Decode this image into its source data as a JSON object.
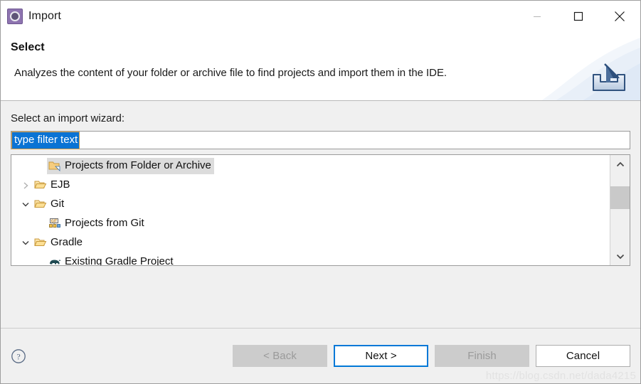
{
  "window": {
    "title": "Import",
    "icon": "eclipse-import-icon",
    "controls": {
      "minimize": "minimize-icon",
      "maximize": "maximize-icon",
      "close": "close-icon"
    }
  },
  "header": {
    "title": "Select",
    "description": "Analyzes the content of your folder or archive file to find projects and import them in the IDE.",
    "banner_icon": "import-banner-icon"
  },
  "main": {
    "field_label": "Select an import wizard:",
    "filter": {
      "value": "type filter text",
      "placeholder": "type filter text",
      "selected": true
    },
    "tree": [
      {
        "label": "Projects from Folder or Archive",
        "icon": "folder-archive-icon",
        "indent": 1,
        "twisty": "none",
        "selected": true
      },
      {
        "label": "EJB",
        "icon": "folder-icon",
        "indent": 0,
        "twisty": "collapsed",
        "selected": false
      },
      {
        "label": "Git",
        "icon": "folder-icon",
        "indent": 0,
        "twisty": "expanded",
        "selected": false
      },
      {
        "label": "Projects from Git",
        "icon": "git-icon",
        "indent": 1,
        "twisty": "none",
        "selected": false
      },
      {
        "label": "Gradle",
        "icon": "folder-icon",
        "indent": 0,
        "twisty": "expanded",
        "selected": false
      },
      {
        "label": "Existing Gradle Project",
        "icon": "gradle-elephant-icon",
        "indent": 1,
        "twisty": "none",
        "selected": false
      }
    ],
    "scrollbar": {
      "up": "chevron-up-icon",
      "down": "chevron-down-icon"
    }
  },
  "footer": {
    "help_icon": "help-question-icon",
    "buttons": [
      {
        "label": "< Back",
        "state": "disabled"
      },
      {
        "label": "Next >",
        "state": "focus"
      },
      {
        "label": "Finish",
        "state": "disabled"
      },
      {
        "label": "Cancel",
        "state": "enabled"
      }
    ]
  },
  "watermark": "https://blog.csdn.net/dada4215",
  "colors": {
    "accent": "#0078d7",
    "selection": "#0a73d4",
    "dialog_bg": "#f0f0f0",
    "tree_selection": "#dcdcdc"
  }
}
